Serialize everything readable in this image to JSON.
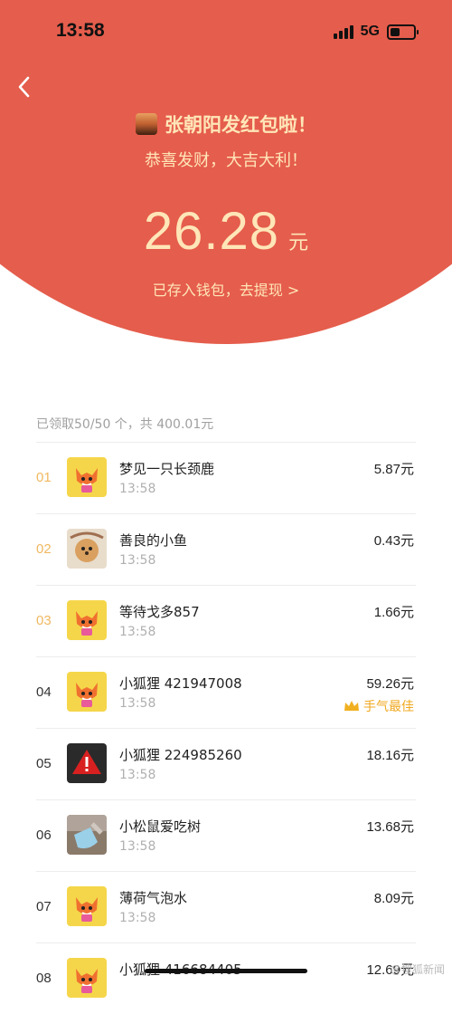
{
  "status": {
    "time": "13:58",
    "network": "5G"
  },
  "header": {
    "title": "张朝阳发红包啦！",
    "subtitle": "恭喜发财，大吉大利！",
    "amount": "26.28",
    "unit": "元",
    "wallet_link": "已存入钱包，去提现 >"
  },
  "summary": "已领取50/50 个，共 400.01元",
  "list": [
    {
      "rank": "01",
      "name": "梦见一只长颈鹿",
      "time": "13:58",
      "amount": "5.87元",
      "avatar": "fox-icon"
    },
    {
      "rank": "02",
      "name": "善良的小鱼",
      "time": "13:58",
      "amount": "0.43元",
      "avatar": "dog-photo"
    },
    {
      "rank": "03",
      "name": "等待戈多857",
      "time": "13:58",
      "amount": "1.66元",
      "avatar": "fox-icon"
    },
    {
      "rank": "04",
      "name": "小狐狸 421947008",
      "time": "13:58",
      "amount": "59.26元",
      "avatar": "fox-icon",
      "badge": "手气最佳"
    },
    {
      "rank": "05",
      "name": "小狐狸 224985260",
      "time": "13:58",
      "amount": "18.16元",
      "avatar": "warning-icon"
    },
    {
      "rank": "06",
      "name": "小松鼠爱吃树",
      "time": "13:58",
      "amount": "13.68元",
      "avatar": "sock-photo"
    },
    {
      "rank": "07",
      "name": "薄荷气泡水",
      "time": "13:58",
      "amount": "8.09元",
      "avatar": "fox-icon"
    },
    {
      "rank": "08",
      "name": "小狐狸 416684405",
      "time": "",
      "amount": "12.69元",
      "avatar": "fox-icon"
    }
  ],
  "watermark": "@搜狐新闻"
}
